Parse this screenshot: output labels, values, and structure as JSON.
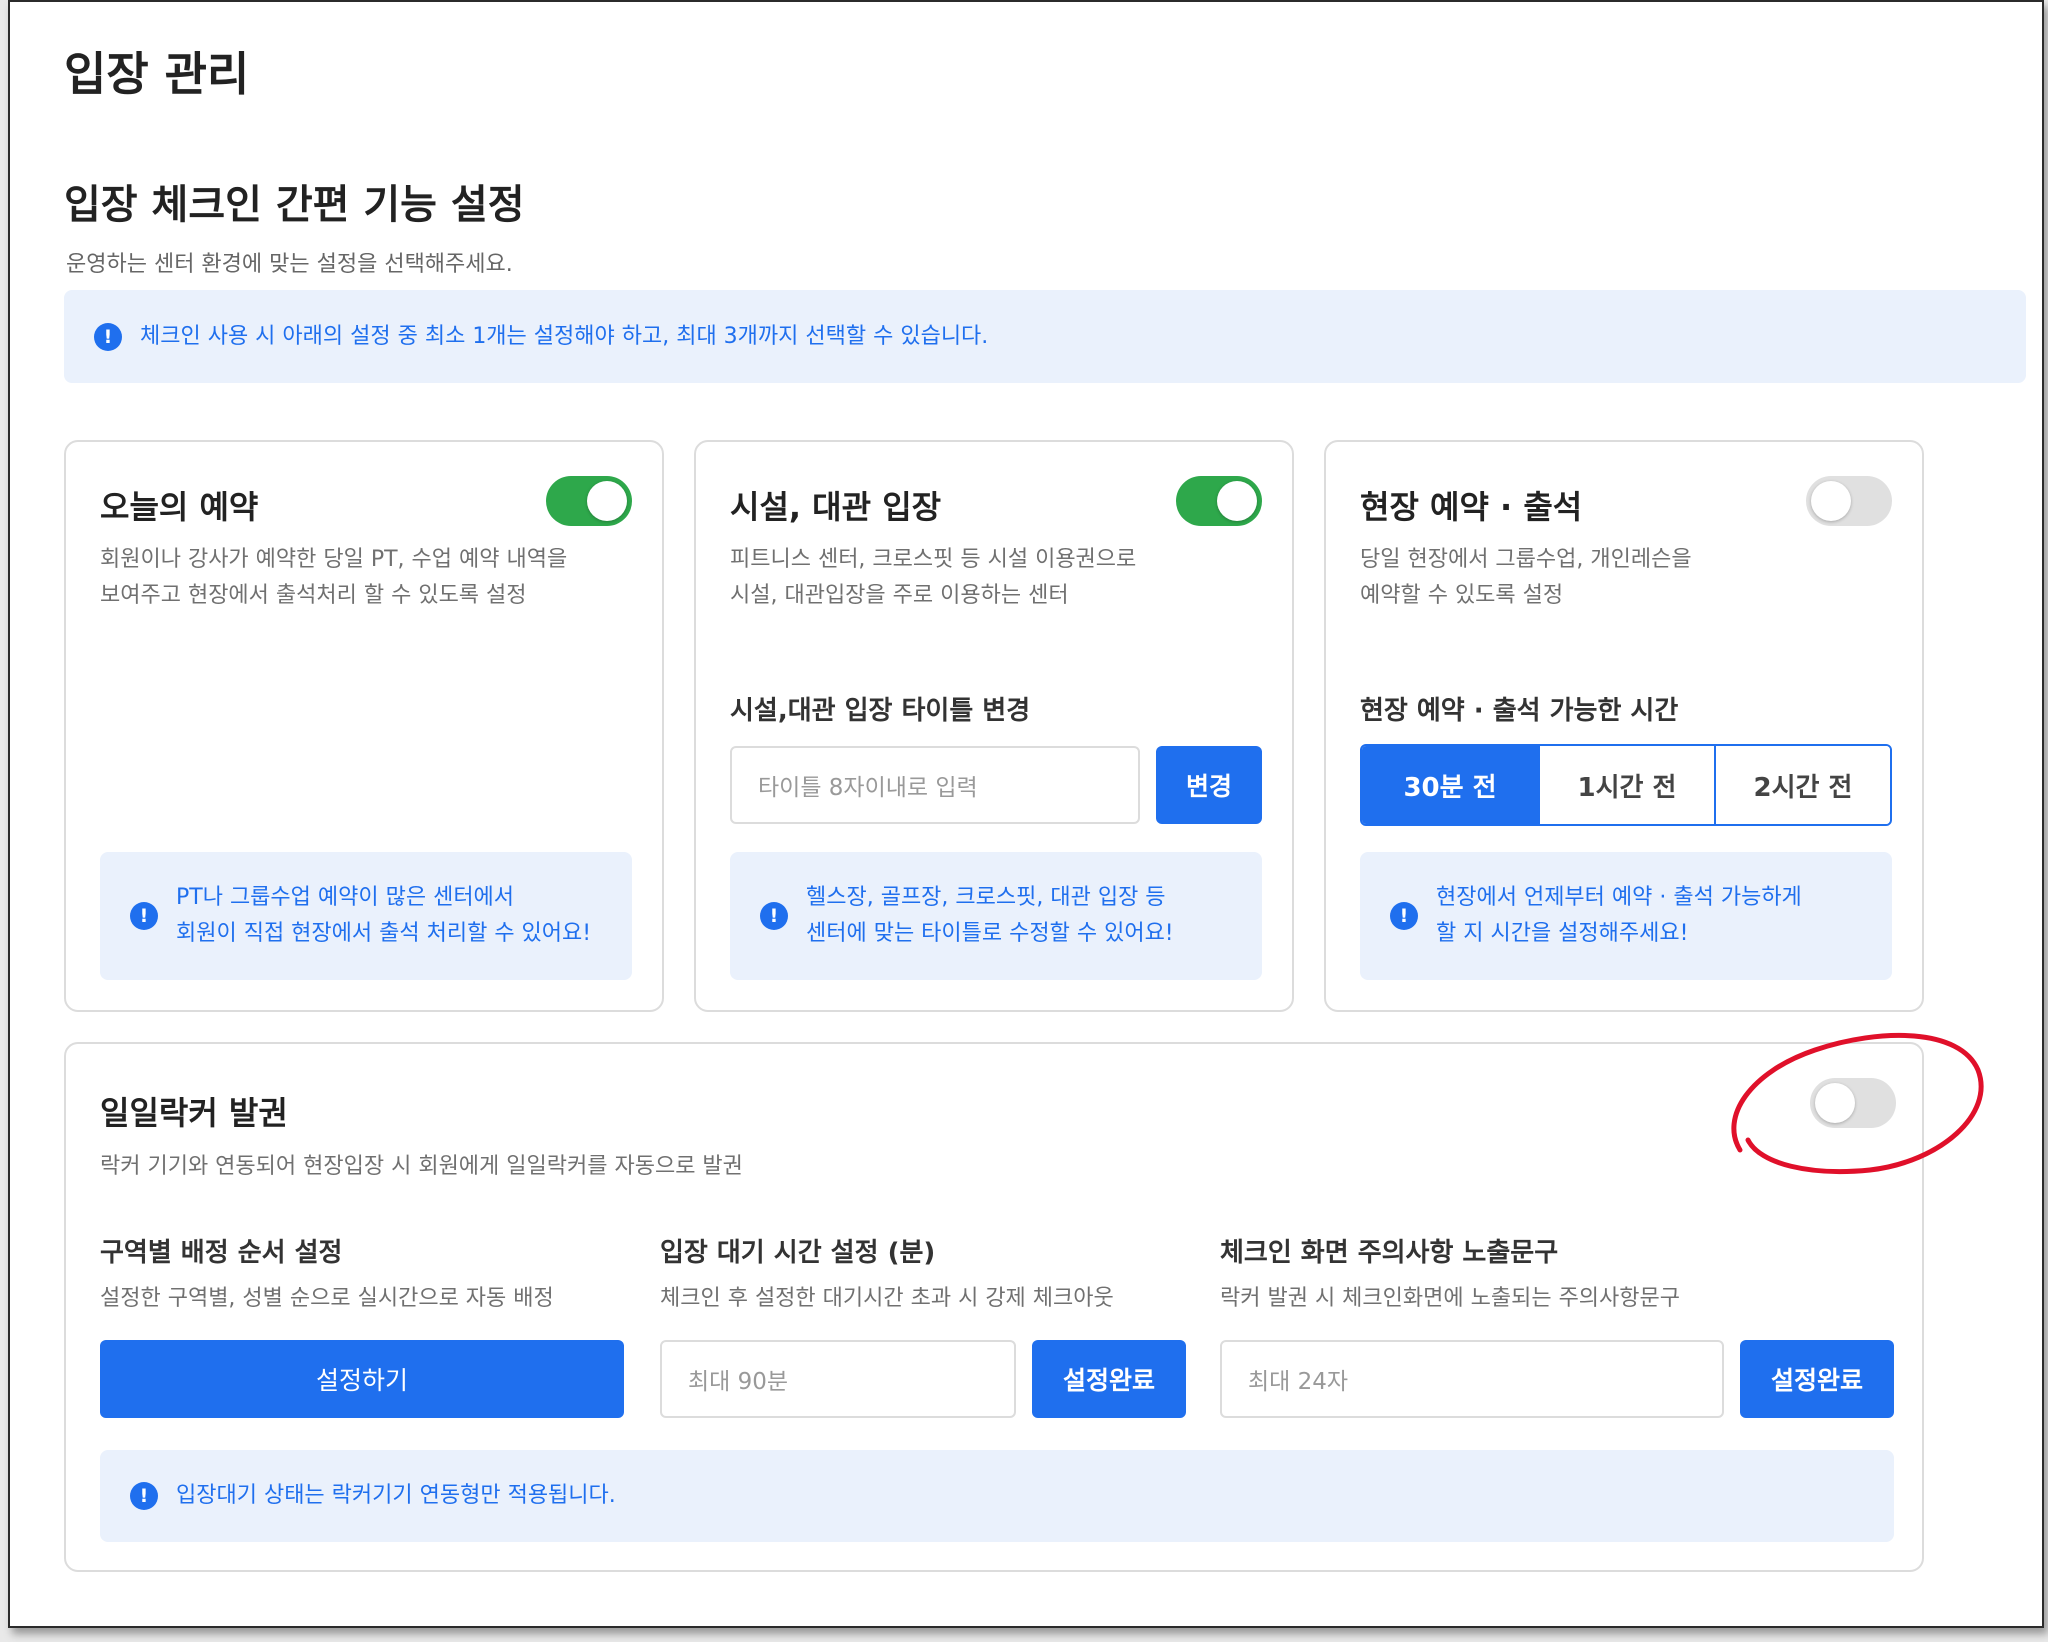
{
  "page": {
    "title": "입장 관리"
  },
  "section": {
    "title": "입장 체크인 간편 기능 설정",
    "description": "운영하는 센터 환경에 맞는 설정을 선택해주세요.",
    "notice": "체크인 사용 시 아래의 설정 중 최소 1개는 설정해야 하고, 최대 3개까지 선택할 수 있습니다."
  },
  "cards": [
    {
      "title": "오늘의 예약",
      "enabled": true,
      "description_lines": [
        "회원이나 강사가 예약한 당일 PT, 수업 예약 내역을",
        "보여주고 현장에서 출석처리 할 수 있도록 설정"
      ],
      "notice_lines": [
        "PT나 그룹수업 예약이 많은 센터에서",
        "회원이 직접 현장에서 출석 처리할 수 있어요!"
      ]
    },
    {
      "title": "시설, 대관 입장",
      "enabled": true,
      "description_lines": [
        "피트니스 센터, 크로스핏 등 시설 이용권으로",
        "시설, 대관입장을 주로 이용하는 센터"
      ],
      "field_label": "시설,대관 입장 타이틀 변경",
      "input_placeholder": "타이틀 8자이내로 입력",
      "button_label": "변경",
      "notice_lines": [
        "헬스장, 골프장, 크로스핏, 대관 입장 등",
        "센터에 맞는 타이틀로 수정할 수 있어요!"
      ]
    },
    {
      "title": "현장 예약 · 출석",
      "enabled": false,
      "description_lines": [
        "당일 현장에서 그룹수업, 개인레슨을",
        "예약할 수 있도록 설정"
      ],
      "field_label": "현장 예약 · 출석 가능한 시간",
      "options": [
        "30분 전",
        "1시간 전",
        "2시간 전"
      ],
      "selected_option": "30분 전",
      "notice_lines": [
        "현장에서 언제부터 예약 · 출석 가능하게",
        "할 지 시간을 설정해주세요!"
      ]
    }
  ],
  "locker": {
    "title": "일일락커 발권",
    "enabled": false,
    "description": "락커 기기와 연동되어 현장입장 시 회원에게 일일락커를 자동으로 발권",
    "zone_order": {
      "label": "구역별 배정 순서 설정",
      "description": "설정한 구역별, 성별 순으로 실시간으로 자동 배정",
      "button_label": "설정하기"
    },
    "wait_time": {
      "label": "입장 대기 시간 설정 (분)",
      "description": "체크인 후 설정한 대기시간 초과 시 강제 체크아웃",
      "input_placeholder": "최대 90분",
      "button_label": "설정완료"
    },
    "caution_text": {
      "label": "체크인 화면 주의사항 노출문구",
      "description": "락커 발권 시 체크인화면에 노출되는 주의사항문구",
      "input_placeholder": "최대 24자",
      "button_label": "설정완료"
    },
    "notice": "입장대기 상태는 락커기기 연동형만 적용됩니다."
  },
  "colors": {
    "accent": "#1f6fee",
    "toggle_on": "#2ea84b",
    "toggle_off": "#e0e0e0",
    "notice_bg": "#eaf1fc",
    "annotation": "#e0102a"
  },
  "icons": {
    "info": "info-icon"
  }
}
